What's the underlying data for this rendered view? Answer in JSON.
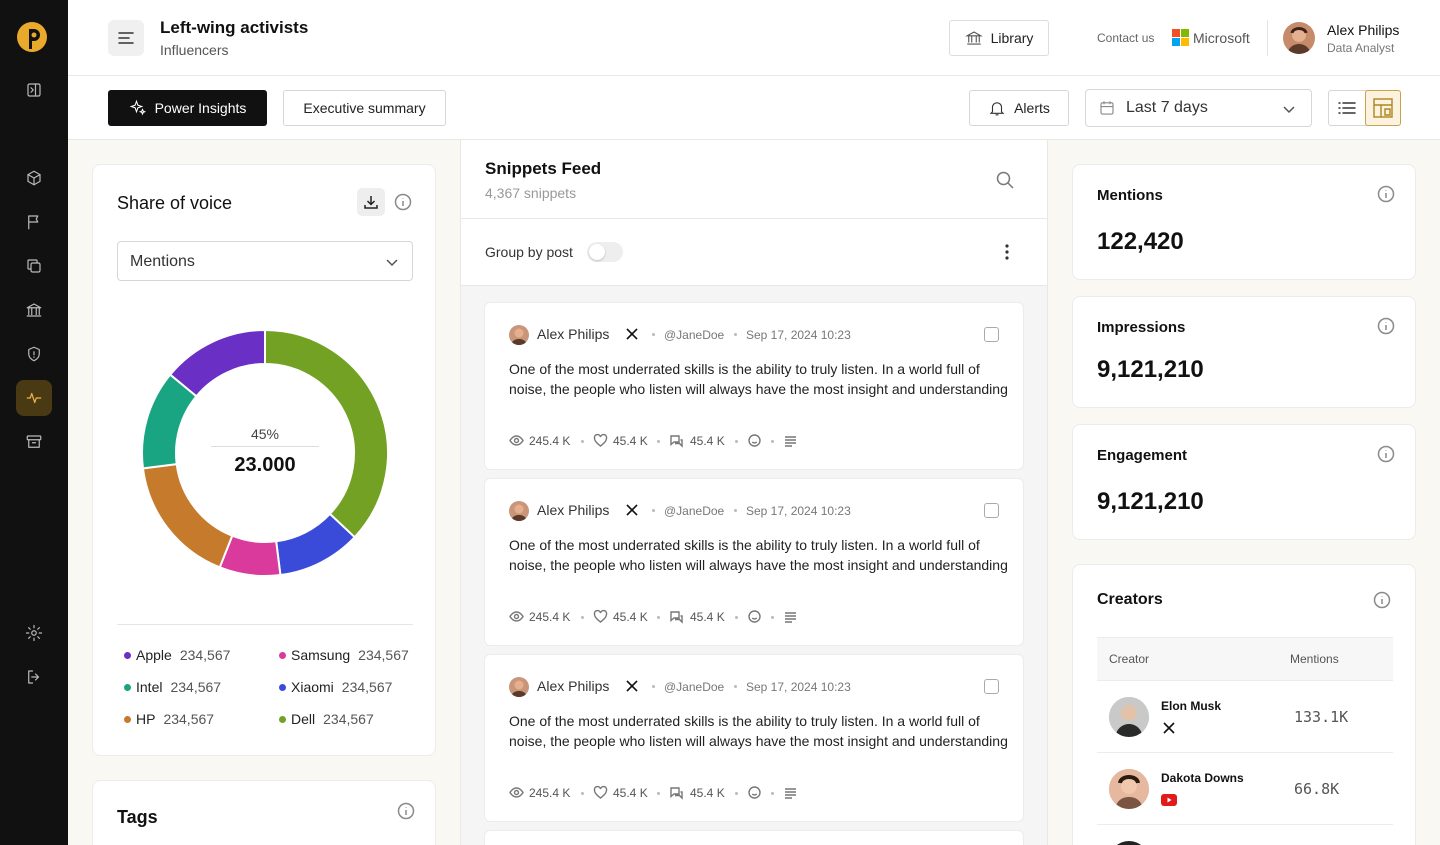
{
  "header": {
    "title": "Left-wing activists",
    "subtitle": "Influencers",
    "library_label": "Library",
    "contact_label": "Contact us",
    "brand_label": "Microsoft",
    "user_name": "Alex Philips",
    "user_role": "Data Analyst"
  },
  "toolbar": {
    "power_insights_label": "Power Insights",
    "executive_summary_label": "Executive summary",
    "alerts_label": "Alerts",
    "date_range": "Last 7 days"
  },
  "sidebar": {
    "items": [
      {
        "icon": "collapse-panel-icon"
      },
      {
        "icon": "cube-icon"
      },
      {
        "icon": "flag-icon"
      },
      {
        "icon": "copy-icon"
      },
      {
        "icon": "bank-icon"
      },
      {
        "icon": "shield-icon"
      },
      {
        "icon": "activity-icon",
        "active": true
      },
      {
        "icon": "archive-icon"
      },
      {
        "icon": "settings-icon"
      },
      {
        "icon": "logout-icon"
      }
    ]
  },
  "share_of_voice": {
    "title": "Share of voice",
    "metric_select": "Mentions",
    "center_percent": "45%",
    "center_value": "23.000",
    "legend": [
      {
        "name": "Apple",
        "value": "234,567",
        "color": "#6a2fc4"
      },
      {
        "name": "Samsung",
        "value": "234,567",
        "color": "#d93a9b"
      },
      {
        "name": "Intel",
        "value": "234,567",
        "color": "#1aa582"
      },
      {
        "name": "Xiaomi",
        "value": "234,567",
        "color": "#3a4ad9"
      },
      {
        "name": "HP",
        "value": "234,567",
        "color": "#c67a2c"
      },
      {
        "name": "Dell",
        "value": "234,567",
        "color": "#72a124"
      }
    ]
  },
  "chart_data": {
    "type": "pie",
    "categories": [
      "Dell",
      "Xiaomi",
      "Samsung",
      "HP",
      "Intel",
      "Apple"
    ],
    "values": [
      37,
      11,
      8,
      17,
      13,
      14
    ],
    "colors": [
      "#72a124",
      "#3a4ad9",
      "#d93a9b",
      "#c67a2c",
      "#1aa582",
      "#6a2fc4"
    ]
  },
  "tags": {
    "title": "Tags"
  },
  "feed": {
    "title": "Snippets Feed",
    "count": "4,367 snippets",
    "group_by_label": "Group by post",
    "snippets": [
      {
        "author": "Alex Philips",
        "handle": "@JaneDoe",
        "date": "Sep 17, 2024 10:23",
        "text": "One of the most underrated skills is the ability to truly listen. In a world full of noise, the people who listen will always have the most insight and understanding",
        "views": "245.4 K",
        "likes": "45.4 K",
        "comments": "45.4 K"
      },
      {
        "author": "Alex Philips",
        "handle": "@JaneDoe",
        "date": "Sep 17, 2024 10:23",
        "text": "One of the most underrated skills is the ability to truly listen. In a world full of noise, the people who listen will always have the most insight and understanding",
        "views": "245.4 K",
        "likes": "45.4 K",
        "comments": "45.4 K"
      },
      {
        "author": "Alex Philips",
        "handle": "@JaneDoe",
        "date": "Sep 17, 2024 10:23",
        "text": "One of the most underrated skills is the ability to truly listen. In a world full of noise, the people who listen will always have the most insight and understanding",
        "views": "245.4 K",
        "likes": "45.4 K",
        "comments": "45.4 K"
      }
    ]
  },
  "metrics": [
    {
      "label": "Mentions",
      "value": "122,420"
    },
    {
      "label": "Impressions",
      "value": "9,121,210"
    },
    {
      "label": "Engagement",
      "value": "9,121,210"
    }
  ],
  "creators": {
    "title": "Creators",
    "col_creator": "Creator",
    "col_mentions": "Mentions",
    "rows": [
      {
        "name": "Elon Musk",
        "platform": "x-icon",
        "mentions": "133.1K"
      },
      {
        "name": "Dakota Downs",
        "platform": "youtube-icon",
        "mentions": "66.8K"
      }
    ]
  }
}
